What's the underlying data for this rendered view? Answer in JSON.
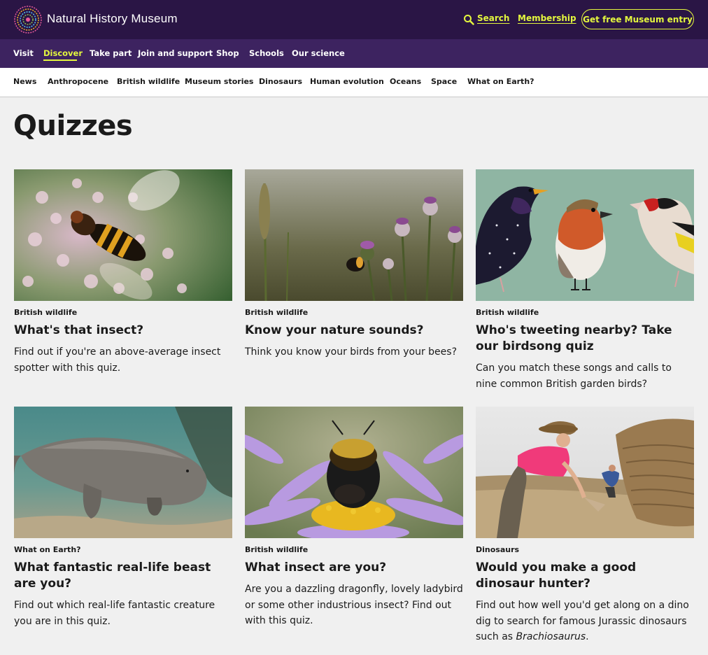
{
  "header": {
    "brand": "Natural History Museum",
    "search_label": "Search",
    "membership_label": "Membership",
    "entry_button": "Get free Museum entry",
    "colors": {
      "bg": "#2a1545",
      "accent": "#e4f73e"
    }
  },
  "main_nav": {
    "items": [
      "Visit",
      "Discover",
      "Take part",
      "Join and support",
      "Shop",
      "Schools",
      "Our science"
    ],
    "active": "Discover"
  },
  "sub_nav": {
    "items": [
      "News",
      "Anthropocene",
      "British wildlife",
      "Museum stories",
      "Dinosaurs",
      "Human evolution",
      "Oceans",
      "Space",
      "What on Earth?"
    ]
  },
  "page": {
    "title": "Quizzes"
  },
  "cards": [
    {
      "category": "British wildlife",
      "title": "What's that insect?",
      "description": "Find out if you're an above-average insect spotter with this quiz."
    },
    {
      "category": "British wildlife",
      "title": "Know your nature sounds?",
      "description": "Think you know your birds from your bees?"
    },
    {
      "category": "British wildlife",
      "title": "Who's tweeting nearby? Take our birdsong quiz",
      "description": "Can you match these songs and calls to nine common British garden birds?"
    },
    {
      "category": "What on Earth?",
      "title": "What fantastic real-life beast are you?",
      "description": "Find out which real-life fantastic creature you are in this quiz."
    },
    {
      "category": "British wildlife",
      "title": "What insect are you?",
      "description": "Are you a dazzling dragonfly, lovely ladybird or some other industrious insect? Find out with this quiz."
    },
    {
      "category": "Dinosaurs",
      "title": "Would you make a good dinosaur hunter?",
      "description": "Find out how well you'd get along on a dino dig to search for famous Jurassic dinosaurs such as ",
      "description_em": "Brachiosaurus",
      "description_end": "."
    }
  ]
}
